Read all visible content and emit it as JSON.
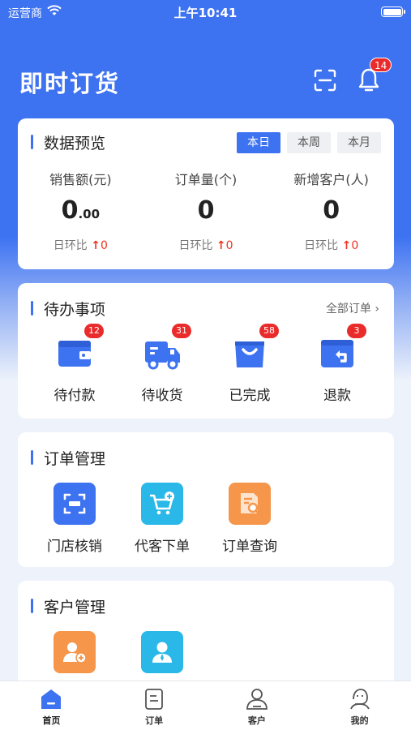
{
  "status_bar": {
    "carrier": "运营商",
    "time": "上午10:41"
  },
  "header": {
    "title": "即时订货",
    "notification_count": "14"
  },
  "overview": {
    "title": "数据预览",
    "tabs": [
      "本日",
      "本周",
      "本月"
    ],
    "active_tab": "本日",
    "stats": [
      {
        "label": "销售额(元)",
        "value_int": "0",
        "value_dec": ".00",
        "ratio_label": "日环比",
        "ratio_value": "0"
      },
      {
        "label": "订单量(个)",
        "value_int": "0",
        "value_dec": "",
        "ratio_label": "日环比",
        "ratio_value": "0"
      },
      {
        "label": "新增客户(人)",
        "value_int": "0",
        "value_dec": "",
        "ratio_label": "日环比",
        "ratio_value": "0"
      }
    ]
  },
  "todo": {
    "title": "待办事项",
    "all_link": "全部订单",
    "items": [
      {
        "label": "待付款",
        "count": "12",
        "icon": "wallet-icon"
      },
      {
        "label": "待收货",
        "count": "31",
        "icon": "truck-icon"
      },
      {
        "label": "已完成",
        "count": "58",
        "icon": "shopping-bag-icon"
      },
      {
        "label": "退款",
        "count": "3",
        "icon": "refund-icon"
      }
    ]
  },
  "order_mgmt": {
    "title": "订单管理",
    "items": [
      {
        "label": "门店核销",
        "icon": "scan-verify-icon",
        "color": "#3d72f1"
      },
      {
        "label": "代客下单",
        "icon": "cart-add-icon",
        "color": "#29b8e8"
      },
      {
        "label": "订单查询",
        "icon": "document-search-icon",
        "color": "#f5964a"
      }
    ]
  },
  "cust_mgmt": {
    "title": "客户管理",
    "items": [
      {
        "label": "",
        "icon": "add-customer-icon",
        "color": "#f5964a"
      },
      {
        "label": "",
        "icon": "customer-list-icon",
        "color": "#29b8e8"
      }
    ]
  },
  "tabbar": {
    "items": [
      {
        "label": "首页",
        "icon": "home-icon",
        "active": true
      },
      {
        "label": "订单",
        "icon": "order-icon",
        "active": false
      },
      {
        "label": "客户",
        "icon": "customer-icon",
        "active": false
      },
      {
        "label": "我的",
        "icon": "profile-icon",
        "active": false
      }
    ]
  },
  "colors": {
    "primary": "#3d72f1",
    "badge": "#ea2b2b",
    "cyan": "#29b8e8",
    "orange": "#f5964a"
  }
}
